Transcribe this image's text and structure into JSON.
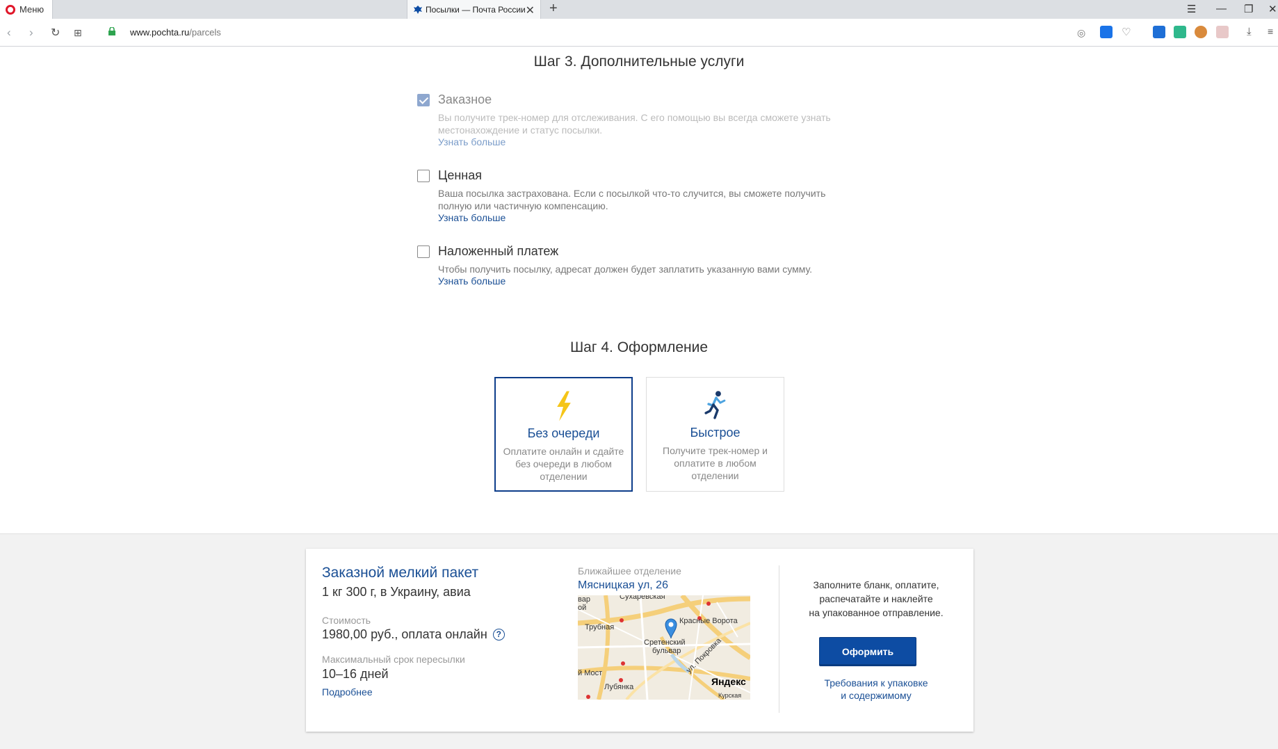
{
  "browser": {
    "menu_label": "Меню",
    "tab_title": "Посылки — Почта России",
    "new_tab": "+",
    "url_domain": "www.pochta.ru",
    "url_path": "/parcels"
  },
  "step3": {
    "title": "Шаг 3. Дополнительные услуги",
    "options": [
      {
        "title": "Заказное",
        "checked": true,
        "disabled": true,
        "desc_line1": "Вы получите трек-номер для отслеживания. С его помощью вы всегда сможете узнать",
        "desc_line2": "местонахождение и статус посылки.",
        "link": "Узнать больше"
      },
      {
        "title": "Ценная",
        "checked": false,
        "desc_line1": "Ваша посылка застрахована. Если с посылкой что-то случится, вы сможете получить",
        "desc_line2": "полную или частичную компенсацию.",
        "link": "Узнать больше"
      },
      {
        "title": "Наложенный платеж",
        "checked": false,
        "desc_line1": "Чтобы получить посылку, адресат должен будет заплатить указанную вами сумму.",
        "link": "Узнать больше"
      }
    ]
  },
  "step4": {
    "title": "Шаг 4. Оформление",
    "cards": [
      {
        "icon": "lightning-icon",
        "title": "Без очереди",
        "desc_line1": "Оплатите онлайн и сдайте",
        "desc_line2": "без очереди в любом",
        "desc_line3": "отделении",
        "selected": true
      },
      {
        "icon": "runner-icon",
        "title": "Быстрое",
        "desc_line1": "Получите трек-номер и",
        "desc_line2": "оплатите в любом",
        "desc_line3": "отделении",
        "selected": false
      }
    ]
  },
  "summary": {
    "title": "Заказной мелкий пакет",
    "subtitle": "1 кг 300 г, в Украину, авиа",
    "cost_label": "Стоимость",
    "cost_value": "1980,00 руб., оплата онлайн",
    "help": "?",
    "term_label": "Максимальный срок пересылки",
    "term_value": "10–16 дней",
    "details_link": "Подробнее",
    "office_label": "Ближайшее отделение",
    "office_address": "Мясницкая ул, 26",
    "map_labels": {
      "l1": "Сухаревская",
      "l2": "вар",
      "l3": "ой",
      "l4": "Трубная",
      "l5": "Красные Ворота",
      "l6": "Сретенский",
      "l7": "бульвар",
      "l8": "ул. Покровка",
      "l9": "й Мост",
      "l10": "Лубянка",
      "l11": "Курская",
      "brand": "Яндекс"
    },
    "instructions_line1": "Заполните бланк, оплатите,",
    "instructions_line2": "распечатайте и наклейте",
    "instructions_line3": "на упакованное отправление.",
    "order_button": "Оформить",
    "requirements_line1": "Требования к упаковке",
    "requirements_line2": "и содержимому"
  },
  "colors": {
    "brand_blue": "#0d4ca3",
    "link_blue": "#1a4f95",
    "lightning": "#f5c518"
  }
}
